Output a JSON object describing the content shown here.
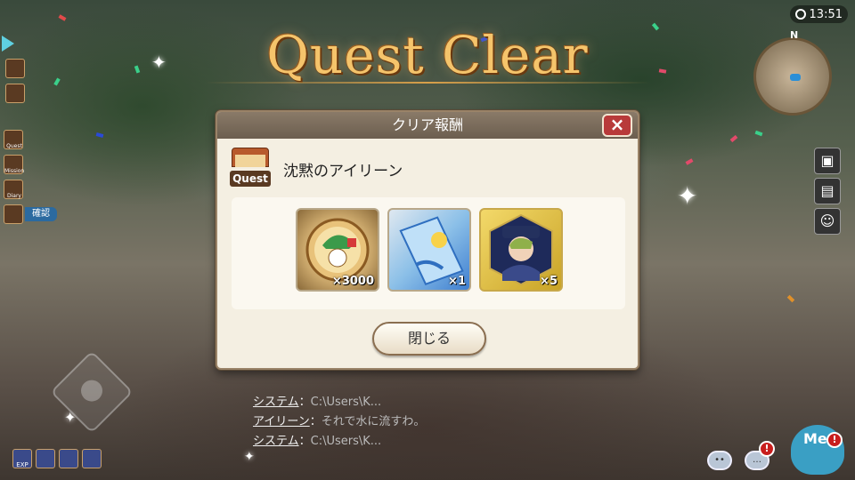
{
  "header": {
    "title": "Quest Clear"
  },
  "clock": {
    "time": "13:51"
  },
  "minimap": {
    "north_label": "N"
  },
  "left_menu": {
    "items": [
      {
        "label": ""
      },
      {
        "label": ""
      },
      {
        "label": "Quest"
      },
      {
        "label": "Mission"
      },
      {
        "label": "Diary"
      },
      {
        "label": ""
      }
    ],
    "confirm_label": "確認"
  },
  "dialog": {
    "header": "クリア報酬",
    "close_icon": "×",
    "quest_badge": "Quest",
    "quest_name": "沈黙のアイリーン",
    "rewards": [
      {
        "name": "coin-medal",
        "qty": "×3000"
      },
      {
        "name": "ticket",
        "qty": "×1"
      },
      {
        "name": "character-portrait",
        "qty": "×5"
      }
    ],
    "close_button": "閉じる"
  },
  "chat": {
    "lines": [
      {
        "who": "システム",
        "sep": "：",
        "msg": "C:\\Users\\K..."
      },
      {
        "who": "アイリーン",
        "sep": "：",
        "msg": "それで水に流すわ。"
      },
      {
        "who": "システム",
        "sep": "：",
        "msg": "C:\\Users\\K..."
      }
    ]
  },
  "bottom_left": {
    "labels": [
      "EXP",
      "",
      "",
      ""
    ]
  },
  "bottom_right": {
    "mascot_label": "Me",
    "alert_mark": "!"
  },
  "colors": {
    "title": "#f5c46b",
    "dialog_bg": "#f4efe2",
    "close_red": "#b83a3a"
  }
}
